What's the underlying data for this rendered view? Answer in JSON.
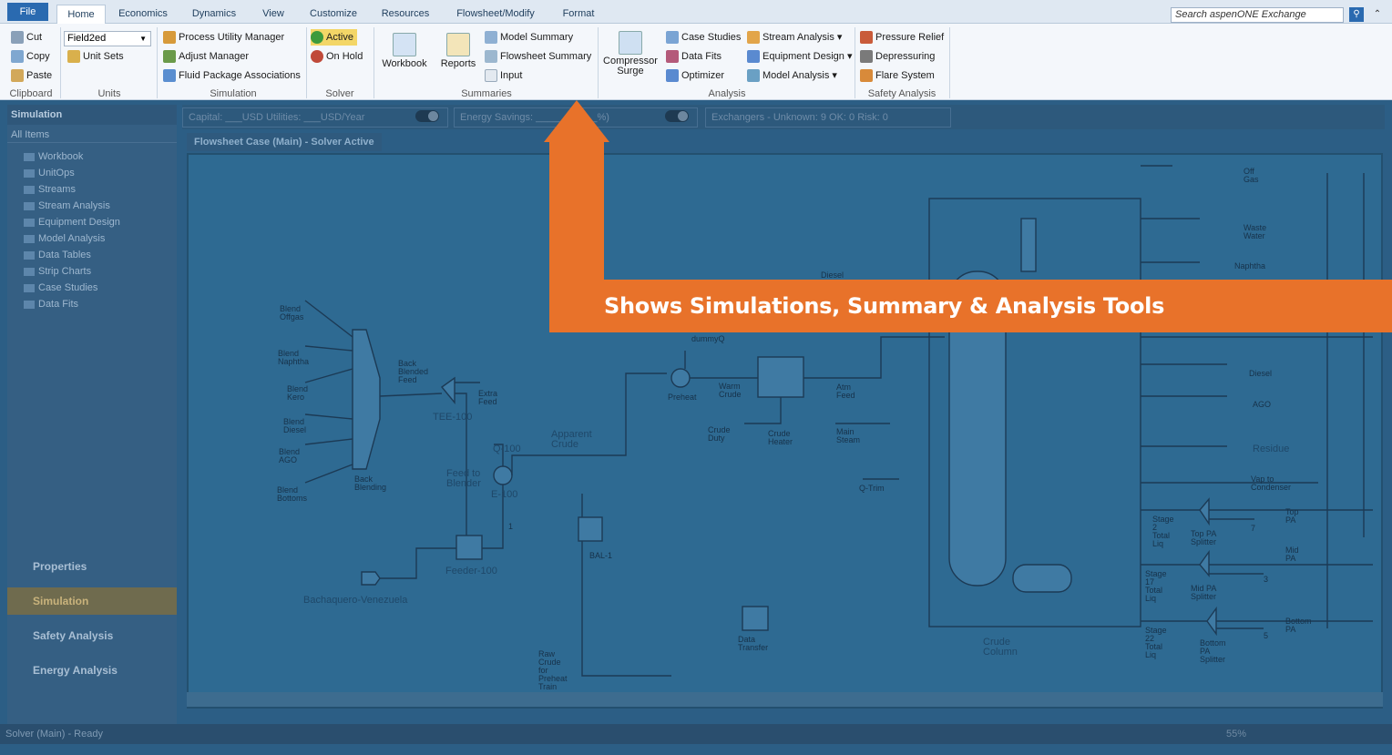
{
  "tabs": [
    "File",
    "Home",
    "Economics",
    "Dynamics",
    "View",
    "Customize",
    "Resources",
    "Flowsheet/Modify",
    "Format"
  ],
  "search": {
    "placeholder": "Search aspenONE Exchange"
  },
  "ribbon": {
    "clipboard": {
      "cut": "Cut",
      "copy": "Copy",
      "paste": "Paste",
      "label": "Clipboard"
    },
    "units": {
      "select": "Field2ed",
      "unit_sets": "Unit Sets",
      "label": "Units"
    },
    "simulation": {
      "pum": "Process Utility Manager",
      "adjust": "Adjust Manager",
      "fluid": "Fluid Package Associations",
      "label": "Simulation"
    },
    "solver": {
      "active": "Active",
      "on_hold": "On Hold",
      "label": "Solver"
    },
    "summaries": {
      "workbook": "Workbook",
      "reports": "Reports",
      "model_summary": "Model Summary",
      "flowsheet_summary": "Flowsheet Summary",
      "input": "Input",
      "label": "Summaries"
    },
    "analysis": {
      "compressor": "Compressor\nSurge",
      "case_studies": "Case Studies",
      "data_fits": "Data Fits",
      "optimizer": "Optimizer",
      "stream_analysis": "Stream Analysis",
      "equipment_design": "Equipment Design",
      "model_analysis": "Model Analysis",
      "label": "Analysis"
    },
    "safety": {
      "pressure_relief": "Pressure Relief",
      "depressuring": "Depressuring",
      "flare_system": "Flare System",
      "label": "Safety Analysis"
    }
  },
  "pane": {
    "title": "Simulation",
    "filter": "All Items",
    "items": [
      "Workbook",
      "UnitOps",
      "Streams",
      "Stream Analysis",
      "Equipment Design",
      "Model Analysis",
      "Data Tables",
      "Strip Charts",
      "Case Studies",
      "Data Fits"
    ],
    "nav": [
      "Properties",
      "Simulation",
      "Safety Analysis",
      "Energy Analysis"
    ]
  },
  "toolbar": {
    "capital": "Capital: ___USD  Utilities: ___USD/Year",
    "energy": "Energy Savings: ___________%)",
    "exchangers": "Exchangers - Unknown: 9   OK: 0   Risk: 0"
  },
  "doc_tab": "Flowsheet Case (Main) - Solver Active",
  "status": {
    "text": "Solver (Main) - Ready",
    "zoom": "55%"
  },
  "flowsheet": {
    "blends": [
      "Blend\nOffgas",
      "Blend\nNaphtha",
      "Blend\nKero",
      "Blend\nDiesel",
      "Blend\nAGO",
      "Blend\nBottoms"
    ],
    "back_blending": "Back\nBlending",
    "back_blended_feed": "Back\nBlended\nFeed",
    "extra_feed": "Extra\nFeed",
    "tee": "TEE-100",
    "q100": "Q-100",
    "feed_to_blender": "Feed to\nBlender",
    "e100": "E-100",
    "apparent_crude": "Apparent\nCrude",
    "feeder": "Feeder-100",
    "bachaquero": "Bachaquero-Venezuela",
    "bal1": "BAL-1",
    "raw_crude": "Raw\nCrude\nfor\nPreheat\nTrain",
    "data_transfer": "Data\nTransfer",
    "preheat": "Preheat",
    "warm_crude": "Warm\nCrude",
    "crude_duty": "Crude\nDuty",
    "crude_heater": "Crude\nHeater",
    "atm_feed": "Atm\nFeed",
    "main_steam": "Main\nSteam",
    "q_trim": "Q-Trim",
    "dummyq": "dummyQ",
    "diesel_top": "Diesel",
    "crude_column": "Crude\nColumn",
    "one": "1",
    "products": [
      "Off\nGas",
      "Waste\nWater",
      "Naphtha",
      "Diesel",
      "AGO",
      "Residue",
      "Vap to\nCondenser"
    ],
    "top_pa": "Top\nPA",
    "mid_pa": "Mid\nPA",
    "bottom_pa": "Bottom\nPA",
    "stage_top": "Stage\n2\nTotal\nLiq",
    "stage_mid": "Stage\n17\nTotal\nLiq",
    "stage_bot": "Stage\n22\nTotal\nLiq",
    "top_pa_splitter": "Top PA\nSplitter",
    "mid_pa_splitter": "Mid PA\nSplitter",
    "bottom_pa_splitter": "Bottom\nPA\nSplitter",
    "num7": "7",
    "num3": "3",
    "num5": "5"
  },
  "callout": {
    "text": "Shows Simulations, Summary & Analysis Tools"
  },
  "colors": {
    "accent": "#e8722a",
    "file_tab": "#2a6ab0",
    "overlay": "#2c5e85"
  }
}
